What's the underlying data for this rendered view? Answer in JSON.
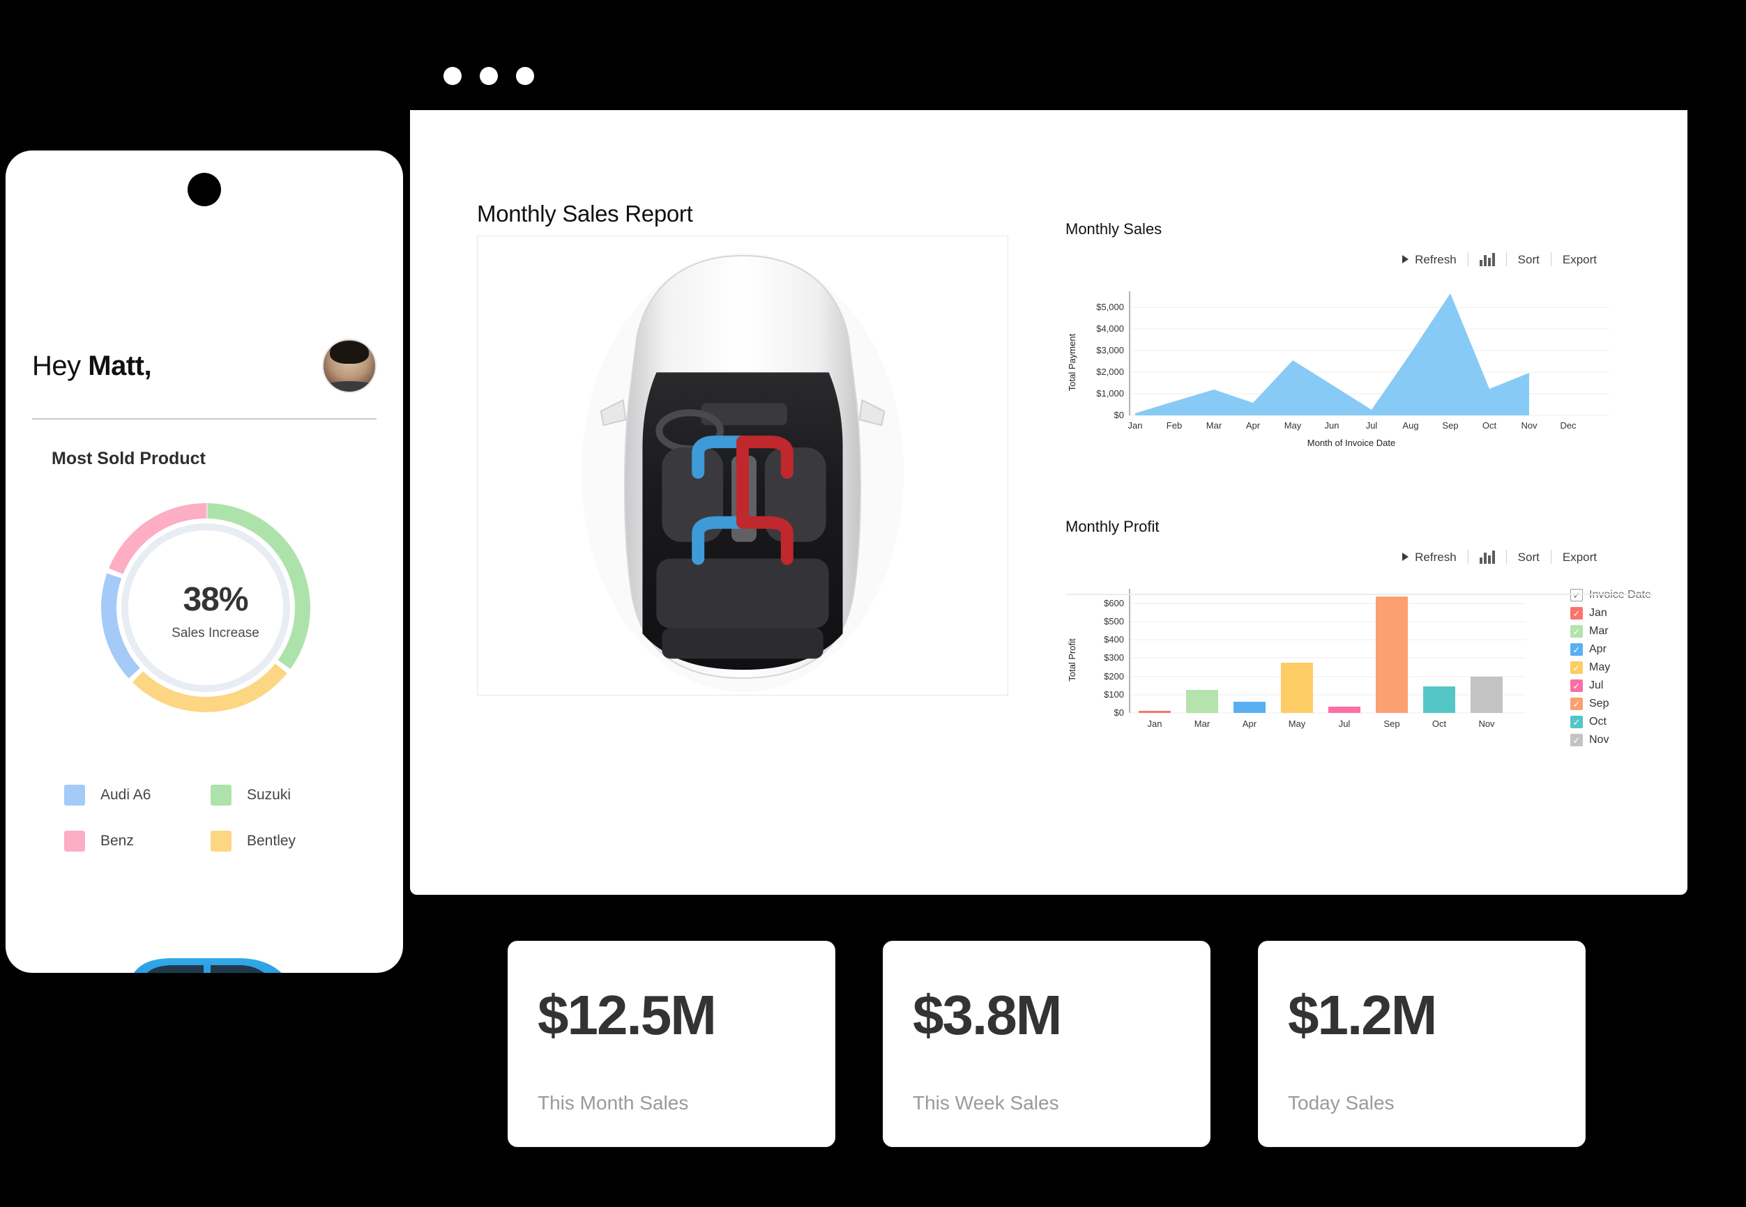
{
  "phone": {
    "greeting_prefix": "Hey ",
    "greeting_name": "Matt,",
    "section_title": "Most Sold Product",
    "donut": {
      "percent": "38%",
      "caption": "Sales Increase"
    },
    "legend": [
      {
        "label": "Audi A6",
        "color": "#a4cbf7"
      },
      {
        "label": "Suzuki",
        "color": "#aee2ab"
      },
      {
        "label": "Benz",
        "color": "#fdadc4"
      },
      {
        "label": "Bentley",
        "color": "#fdd684"
      }
    ]
  },
  "window": {
    "traffic_lights": [
      "close",
      "minimize",
      "maximize"
    ],
    "report_title": "Monthly Sales Report"
  },
  "toolbar": {
    "refresh": "Refresh",
    "sort": "Sort",
    "export": "Export"
  },
  "chart_data": [
    {
      "type": "area",
      "title": "Monthly Sales",
      "xlabel": "Month of Invoice Date",
      "ylabel": "Total Payment",
      "categories": [
        "Jan",
        "Feb",
        "Mar",
        "Apr",
        "May",
        "Jun",
        "Jul",
        "Aug",
        "Sep",
        "Oct",
        "Nov",
        "Dec"
      ],
      "values": [
        100,
        650,
        1200,
        600,
        2580,
        1450,
        280,
        2900,
        5620,
        1220,
        1950,
        null
      ],
      "ytick_labels": [
        "$0",
        "$1,000",
        "$2,000",
        "$3,000",
        "$4,000",
        "$5,000"
      ],
      "ylim": [
        0,
        5800
      ],
      "grid": true,
      "color": "#87caf5",
      "legend_position": "none"
    },
    {
      "type": "bar",
      "title": "Monthly Profit",
      "xlabel": "",
      "ylabel": "Total Profit",
      "categories": [
        "Jan",
        "Mar",
        "Apr",
        "May",
        "Jul",
        "Sep",
        "Oct",
        "Nov"
      ],
      "values": [
        10,
        126,
        60,
        275,
        35,
        640,
        147,
        200
      ],
      "ytick_labels": [
        "$0",
        "$100",
        "$200",
        "$300",
        "$400",
        "$500",
        "$600"
      ],
      "ylim": [
        0,
        680
      ],
      "grid": true,
      "bar_colors": [
        "#f9746d",
        "#b5e2ad",
        "#58b0f2",
        "#fdcc65",
        "#fb6fa5",
        "#fba070",
        "#55c6c6",
        "#c3c3c3"
      ],
      "legend_position": "right",
      "legend_title": "Invoice Date",
      "legend_items": [
        {
          "label": "Jan",
          "color": "#f9746d"
        },
        {
          "label": "Mar",
          "color": "#b5e2ad"
        },
        {
          "label": "Apr",
          "color": "#58b0f2"
        },
        {
          "label": "May",
          "color": "#fdcc65"
        },
        {
          "label": "Jul",
          "color": "#fb6fa5"
        },
        {
          "label": "Sep",
          "color": "#fba070"
        },
        {
          "label": "Oct",
          "color": "#55c6c6"
        },
        {
          "label": "Nov",
          "color": "#c3c3c3"
        }
      ]
    }
  ],
  "stat_cards": [
    {
      "value": "$12.5M",
      "label": "This Month Sales"
    },
    {
      "value": "$3.8M",
      "label": "This Week Sales"
    },
    {
      "value": "$1.2M",
      "label": "Today Sales"
    }
  ]
}
